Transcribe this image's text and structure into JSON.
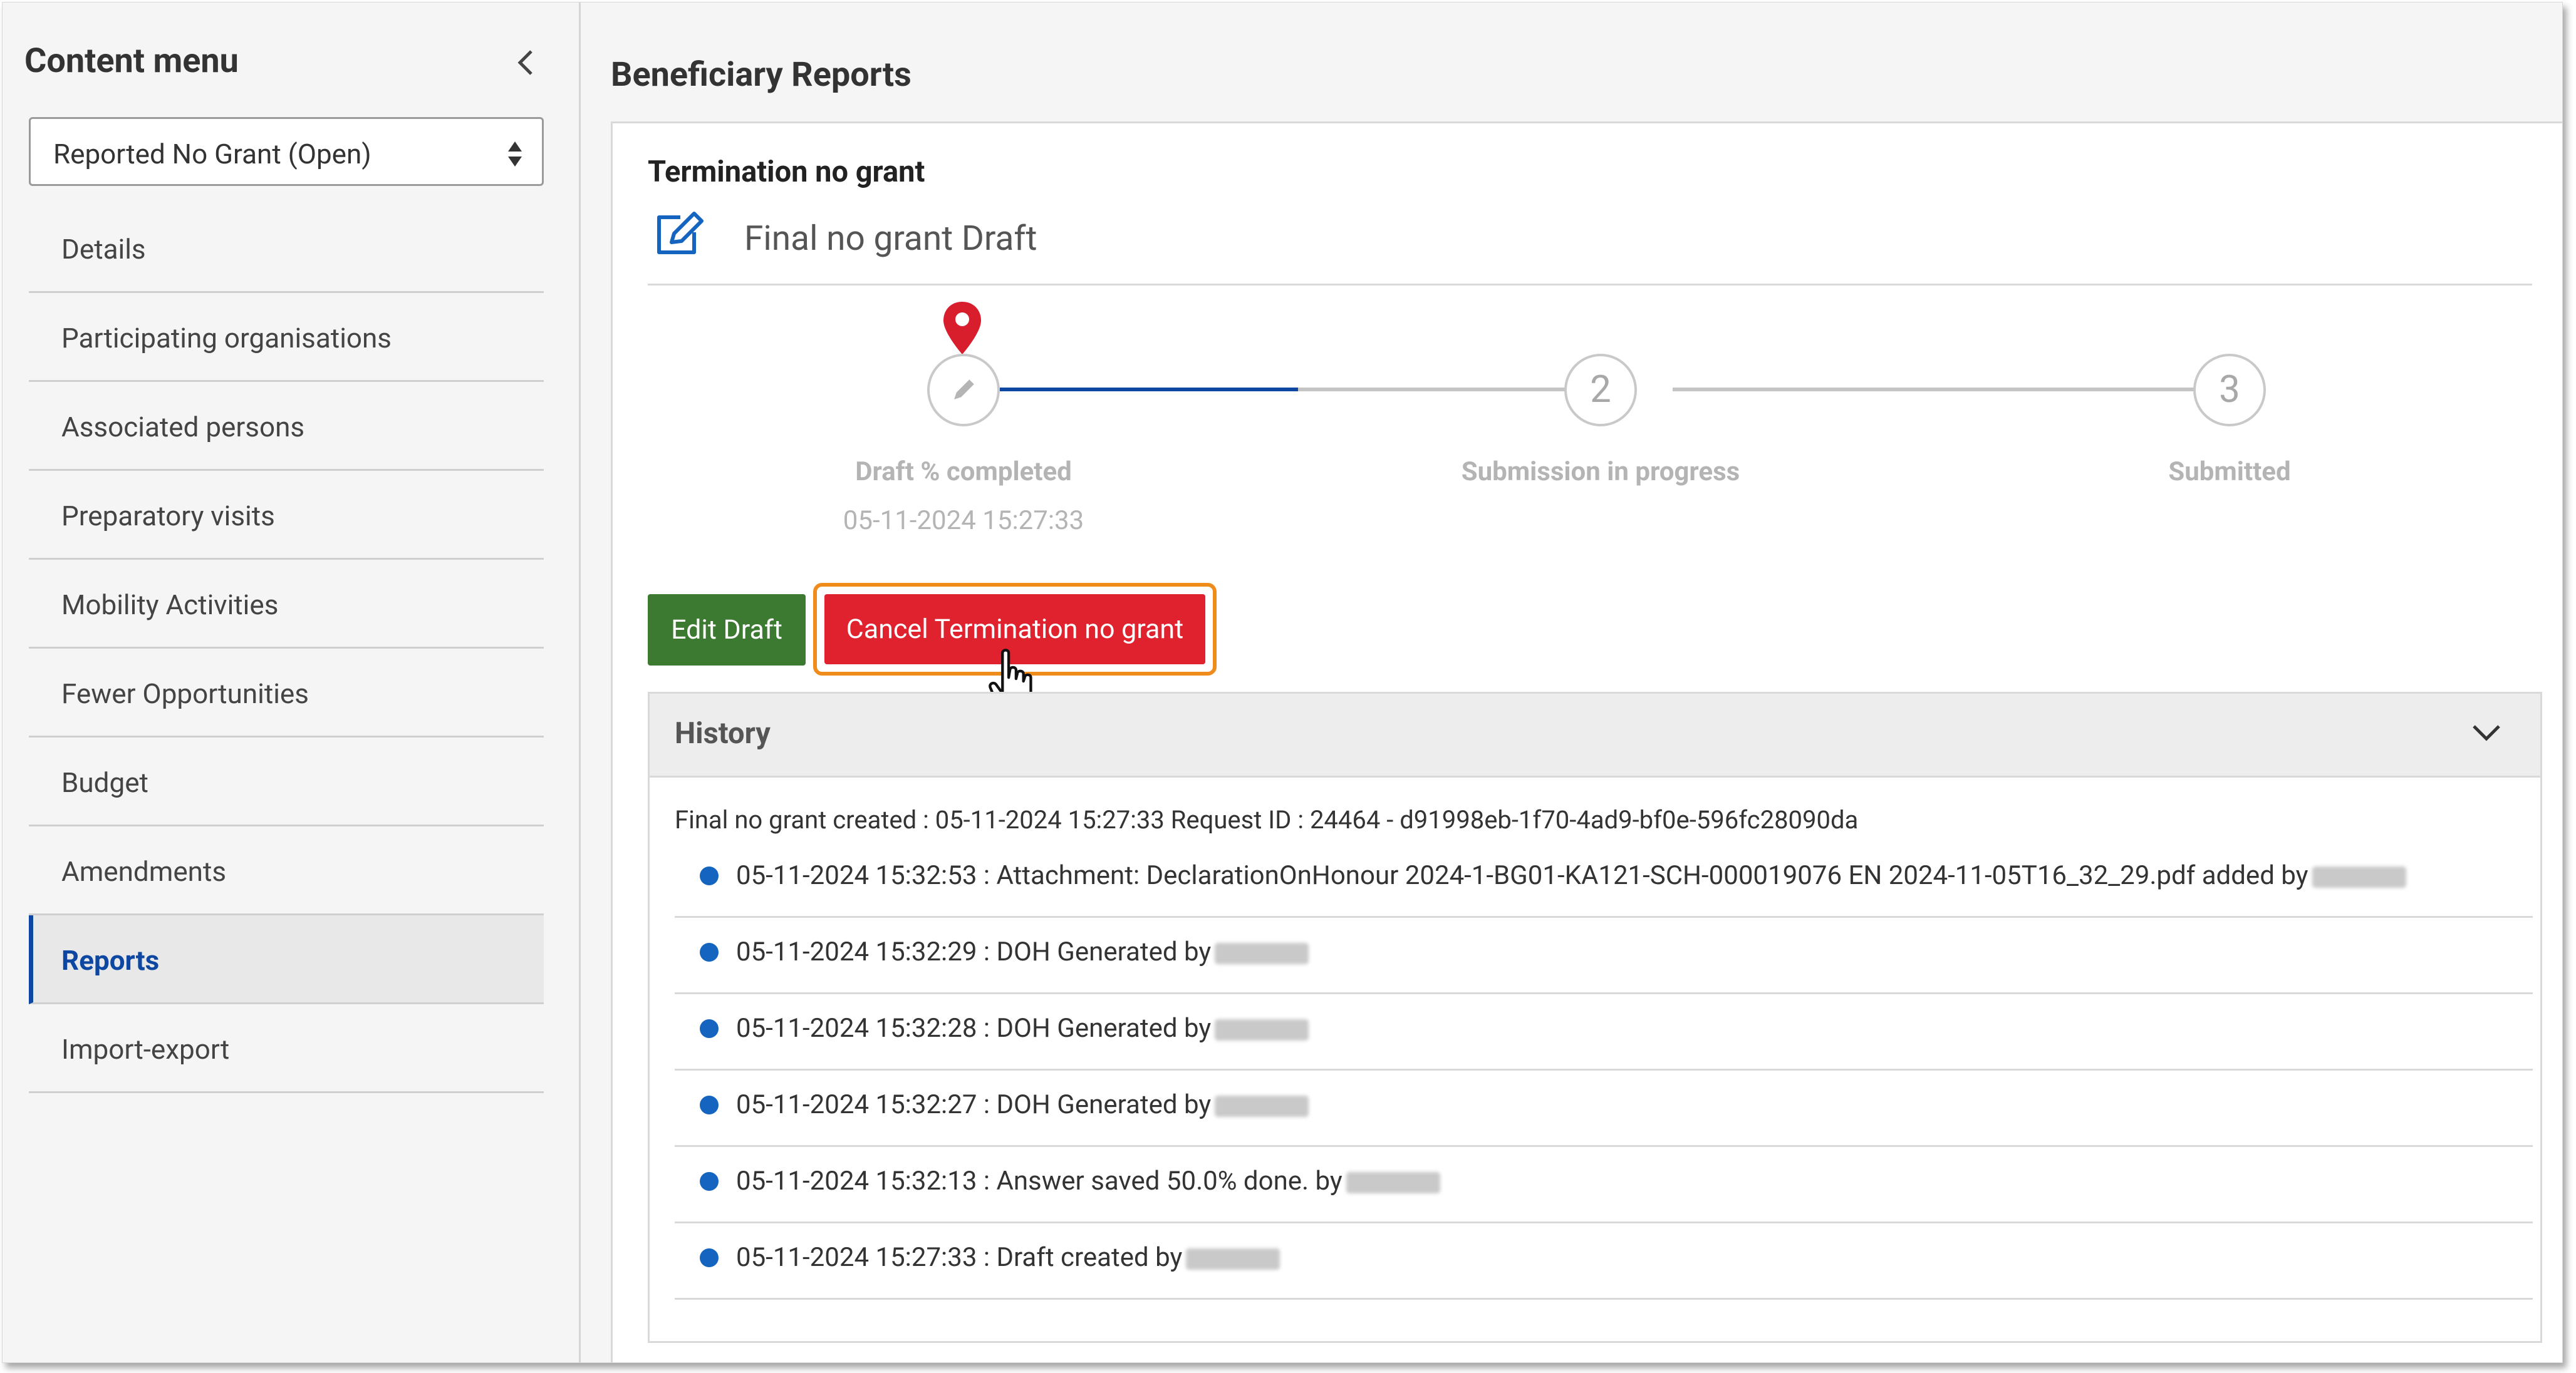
{
  "sidebar": {
    "title": "Content menu",
    "select_value": "Reported No Grant (Open)",
    "items": [
      {
        "label": "Details"
      },
      {
        "label": "Participating organisations"
      },
      {
        "label": "Associated persons"
      },
      {
        "label": "Preparatory visits"
      },
      {
        "label": "Mobility Activities"
      },
      {
        "label": "Fewer Opportunities"
      },
      {
        "label": "Budget"
      },
      {
        "label": "Amendments"
      },
      {
        "label": "Reports"
      },
      {
        "label": "Import-export"
      }
    ]
  },
  "main": {
    "title": "Beneficiary Reports",
    "card_title": "Termination no grant",
    "status": "Final no grant Draft",
    "steps": [
      {
        "number": "",
        "label": "Draft % completed",
        "date": "05-11-2024 15:27:33"
      },
      {
        "number": "2",
        "label": "Submission in progress"
      },
      {
        "number": "3",
        "label": "Submitted"
      }
    ],
    "buttons": {
      "edit": "Edit Draft",
      "cancel": "Cancel Termination no grant"
    },
    "history": {
      "title": "History",
      "created": "Final no grant created : 05-11-2024 15:27:33 Request ID : 24464 - d91998eb-1f70-4ad9-bf0e-596fc28090da",
      "entries": [
        {
          "text": "05-11-2024 15:32:53 : Attachment: DeclarationOnHonour 2024-1-BG01-KA121-SCH-000019076 EN 2024-11-05T16_32_29.pdf added by"
        },
        {
          "text": "05-11-2024 15:32:29 : DOH Generated by"
        },
        {
          "text": "05-11-2024 15:32:28 : DOH Generated by"
        },
        {
          "text": "05-11-2024 15:32:27 : DOH Generated by"
        },
        {
          "text": "05-11-2024 15:32:13 : Answer saved 50.0% done. by"
        },
        {
          "text": "05-11-2024 15:27:33 : Draft created by"
        }
      ]
    }
  },
  "colors": {
    "accent_blue": "#0e47a1",
    "edit_green": "#3d7a31",
    "cancel_red": "#e0222f",
    "highlight_orange": "#ef8c1c",
    "pin_red": "#d81e2d"
  },
  "icons": [
    "chevron-left-icon",
    "sort-arrows-icon",
    "edit-square-icon",
    "pencil-icon",
    "location-pin-icon",
    "chevron-down-icon",
    "hand-cursor-icon",
    "bullet-icon"
  ]
}
